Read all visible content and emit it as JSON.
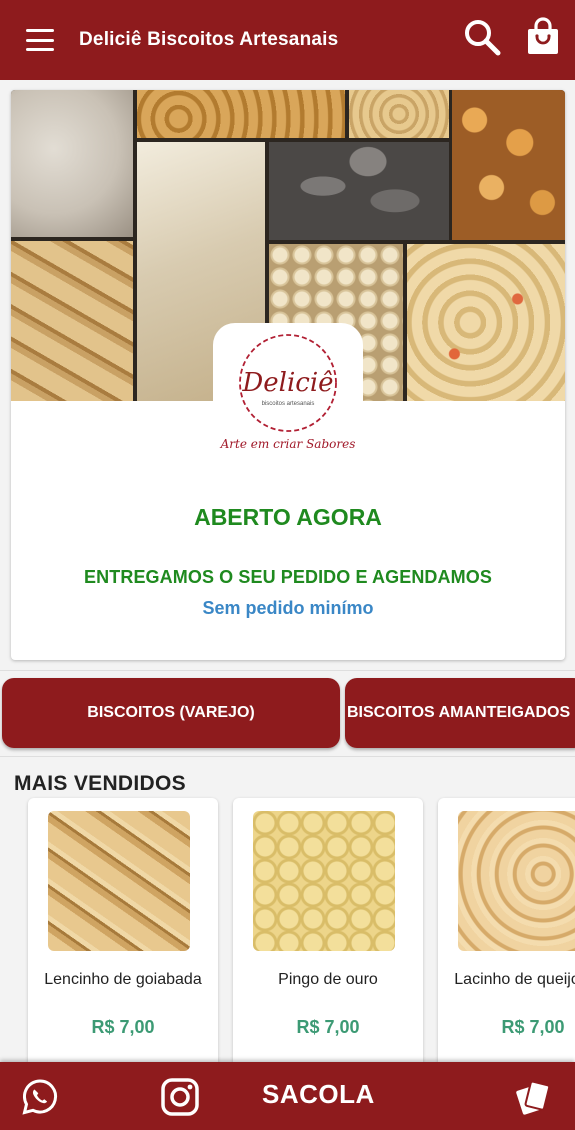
{
  "header": {
    "title": "Deliciê Biscoitos Artesanais",
    "menu_icon": "hamburger-menu-icon",
    "search_icon": "search-icon",
    "bag_icon": "shopping-bag-icon",
    "background": "#8e1b1d"
  },
  "store": {
    "logo_text": "Deliciê",
    "logo_subtext": "biscoitos artesanais",
    "tagline": "Arte em criar Sabores",
    "status": "ABERTO AGORA",
    "delivery_info": "ENTREGAMOS O SEU PEDIDO E AGENDAMOS",
    "min_order": "Sem pedido minímo",
    "status_color": "#1f8a1f",
    "min_order_color": "#3a87c6"
  },
  "categories": [
    {
      "label": "BISCOITOS (VAREJO)"
    },
    {
      "label": "BISCOITOS AMANTEIGADOS"
    }
  ],
  "best_sellers": {
    "title": "MAIS VENDIDOS",
    "products": [
      {
        "name": "Lencinho de goiabada",
        "price": "R$ 7,00"
      },
      {
        "name": "Pingo de ouro",
        "price": "R$ 7,00"
      },
      {
        "name": "Lacinho de queijo",
        "price": "R$ 7,00"
      }
    ]
  },
  "bottom_bar": {
    "whatsapp_icon": "whatsapp-icon",
    "instagram_icon": "instagram-icon",
    "bag_label": "SACOLA",
    "cards_icon": "payment-cards-icon"
  }
}
